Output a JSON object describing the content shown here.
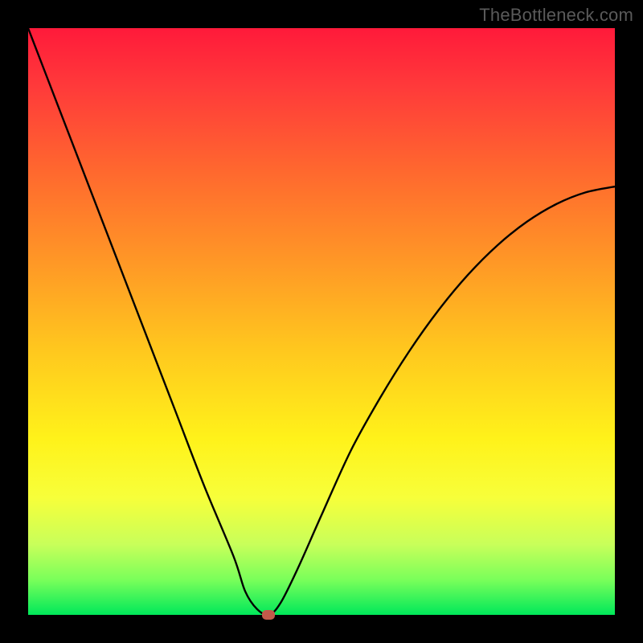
{
  "watermark": "TheBottleneck.com",
  "chart_data": {
    "type": "line",
    "title": "",
    "xlabel": "",
    "ylabel": "",
    "xlim": [
      0,
      100
    ],
    "ylim": [
      0,
      100
    ],
    "grid": false,
    "legend": false,
    "background_gradient": {
      "top": "#ff1a3a",
      "mid": "#fff21a",
      "bottom": "#00e85a"
    },
    "series": [
      {
        "name": "bottleneck-curve",
        "color": "#000000",
        "x": [
          0,
          5,
          10,
          15,
          20,
          25,
          30,
          35,
          37,
          39,
          41,
          43,
          46,
          50,
          55,
          60,
          65,
          70,
          75,
          80,
          85,
          90,
          95,
          100
        ],
        "values": [
          100,
          87,
          74,
          61,
          48,
          35,
          22,
          10,
          4,
          1,
          0,
          2,
          8,
          17,
          28,
          37,
          45,
          52,
          58,
          63,
          67,
          70,
          72,
          73
        ]
      }
    ],
    "marker": {
      "name": "optimal-point",
      "x": 41,
      "y": 0,
      "color": "#c25a4a"
    }
  }
}
